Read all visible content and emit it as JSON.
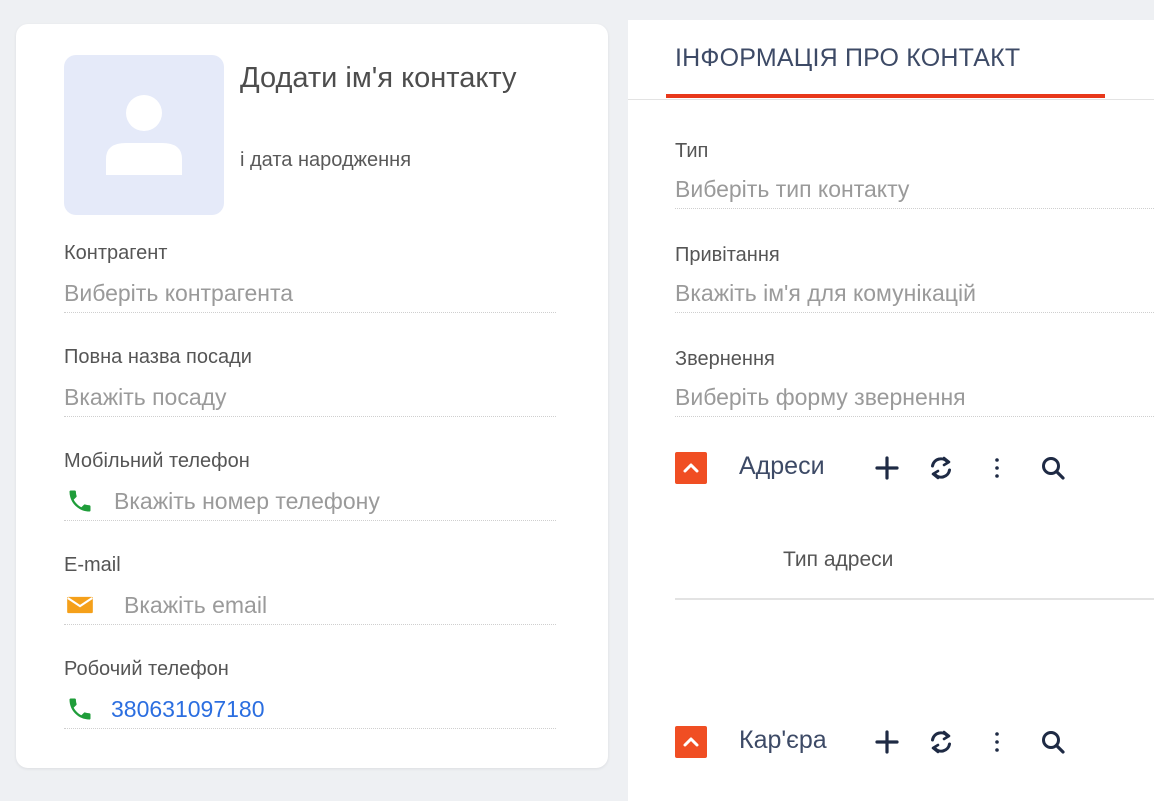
{
  "contact": {
    "name_placeholder": "Додати ім'я контакту",
    "birth_date_placeholder": "і дата народження"
  },
  "left_fields": [
    {
      "label": "Контрагент",
      "value": "Виберіть контрагента"
    },
    {
      "label": "Повна назва посади",
      "value": "Вкажіть посаду"
    },
    {
      "label": "Мобільний телефон",
      "value": "Вкажіть номер телефону",
      "icon": "phone-icon"
    },
    {
      "label": "E-mail",
      "value": "Вкажіть email",
      "icon": "envelope-icon"
    },
    {
      "label": "Робочий телефон",
      "value": "380631097180",
      "icon": "phone-icon"
    }
  ],
  "tab": {
    "title": "ІНФОРМАЦІЯ ПРО КОНТАКТ"
  },
  "right_fields": [
    {
      "label": "Тип",
      "value": "Виберіть тип контакту"
    },
    {
      "label": "Привітання",
      "value": "Вкажіть ім'я для комунікацій"
    },
    {
      "label": "Звернення",
      "value": "Виберіть форму звернення"
    }
  ],
  "sections": [
    {
      "title": "Адреси",
      "columns": [
        "Тип адреси"
      ]
    },
    {
      "title": "Кар'єра"
    }
  ],
  "colors": {
    "accent": "#f04e23",
    "tab_underline": "#e8381b",
    "phone_icon": "#1f9d3a",
    "email_icon": "#f5a01a",
    "link": "#2b6ee0",
    "avatar_bg": "#e5eaf9"
  }
}
